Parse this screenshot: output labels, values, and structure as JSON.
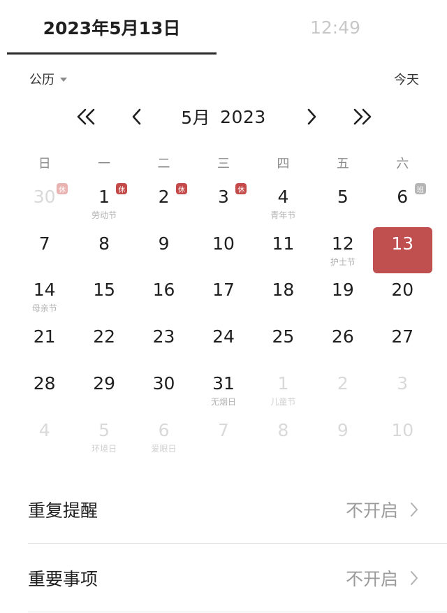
{
  "tabs": {
    "date": "2023年5月13日",
    "time": "12:49"
  },
  "header": {
    "calendar_type": "公历",
    "today": "今天"
  },
  "month_nav": {
    "month": "5月",
    "year": "2023"
  },
  "weekdays": [
    "日",
    "一",
    "二",
    "三",
    "四",
    "五",
    "六"
  ],
  "badges": {
    "off": "休",
    "work": "班"
  },
  "days": [
    {
      "num": "30",
      "other": true,
      "badge": "off"
    },
    {
      "num": "1",
      "sub": "劳动节",
      "badge": "off"
    },
    {
      "num": "2",
      "badge": "off"
    },
    {
      "num": "3",
      "badge": "off"
    },
    {
      "num": "4",
      "sub": "青年节"
    },
    {
      "num": "5"
    },
    {
      "num": "6",
      "badge": "work"
    },
    {
      "num": "7"
    },
    {
      "num": "8"
    },
    {
      "num": "9"
    },
    {
      "num": "10"
    },
    {
      "num": "11"
    },
    {
      "num": "12",
      "sub": "护士节"
    },
    {
      "num": "13",
      "selected": true
    },
    {
      "num": "14",
      "sub": "母亲节"
    },
    {
      "num": "15"
    },
    {
      "num": "16"
    },
    {
      "num": "17"
    },
    {
      "num": "18"
    },
    {
      "num": "19"
    },
    {
      "num": "20"
    },
    {
      "num": "21"
    },
    {
      "num": "22"
    },
    {
      "num": "23"
    },
    {
      "num": "24"
    },
    {
      "num": "25"
    },
    {
      "num": "26"
    },
    {
      "num": "27"
    },
    {
      "num": "28"
    },
    {
      "num": "29"
    },
    {
      "num": "30"
    },
    {
      "num": "31",
      "sub": "无烟日"
    },
    {
      "num": "1",
      "sub": "儿童节",
      "other": true
    },
    {
      "num": "2",
      "other": true
    },
    {
      "num": "3",
      "other": true
    },
    {
      "num": "4",
      "other": true
    },
    {
      "num": "5",
      "sub": "环境日",
      "other": true
    },
    {
      "num": "6",
      "sub": "爱眼日",
      "other": true
    },
    {
      "num": "7",
      "other": true
    },
    {
      "num": "8",
      "other": true
    },
    {
      "num": "9",
      "other": true
    },
    {
      "num": "10",
      "other": true
    }
  ],
  "settings": [
    {
      "label": "重复提醒",
      "value": "不开启"
    },
    {
      "label": "重要事项",
      "value": "不开启"
    }
  ],
  "colors": {
    "selected": "#c0504f",
    "off_badge": "#c34a48",
    "work_badge": "#b5b5b5",
    "muted": "#9b9b9b"
  }
}
